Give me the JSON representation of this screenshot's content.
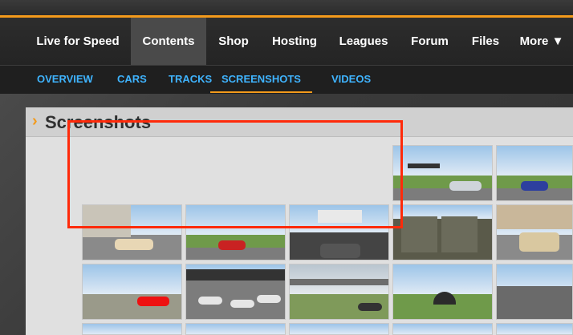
{
  "nav": {
    "items": [
      {
        "label": "Live for Speed"
      },
      {
        "label": "Contents"
      },
      {
        "label": "Shop"
      },
      {
        "label": "Hosting"
      },
      {
        "label": "Leagues"
      },
      {
        "label": "Forum"
      },
      {
        "label": "Files"
      },
      {
        "label": "More ▼"
      }
    ],
    "active": "Contents"
  },
  "subnav": {
    "items": [
      {
        "label": "OVERVIEW"
      },
      {
        "label": "CARS"
      },
      {
        "label": "TRACKS"
      },
      {
        "label": "SCREENSHOTS"
      },
      {
        "label": "VIDEOS"
      }
    ],
    "active": "SCREENSHOTS"
  },
  "panel": {
    "title": "Screenshots"
  },
  "thumbnails": [
    {
      "subject": "formula car at trackside gantry"
    },
    {
      "subject": "formula car on circuit"
    },
    {
      "subject": "silver sports car by building"
    },
    {
      "subject": "red race car on track"
    },
    {
      "subject": "cockpit view with overlay"
    },
    {
      "subject": "pit garage interior"
    },
    {
      "subject": "hatchback car by building"
    },
    {
      "subject": "cloudy circuit"
    },
    {
      "subject": "red sports car on airfield"
    },
    {
      "subject": "formula cars on grid, Rockingham"
    },
    {
      "subject": "grandstand straight"
    },
    {
      "subject": "tunnel entrance"
    },
    {
      "subject": "banked oval"
    }
  ],
  "colors": {
    "accent": "#f39a1b",
    "link": "#3fb4ff",
    "highlight": "#ff2a0a"
  }
}
